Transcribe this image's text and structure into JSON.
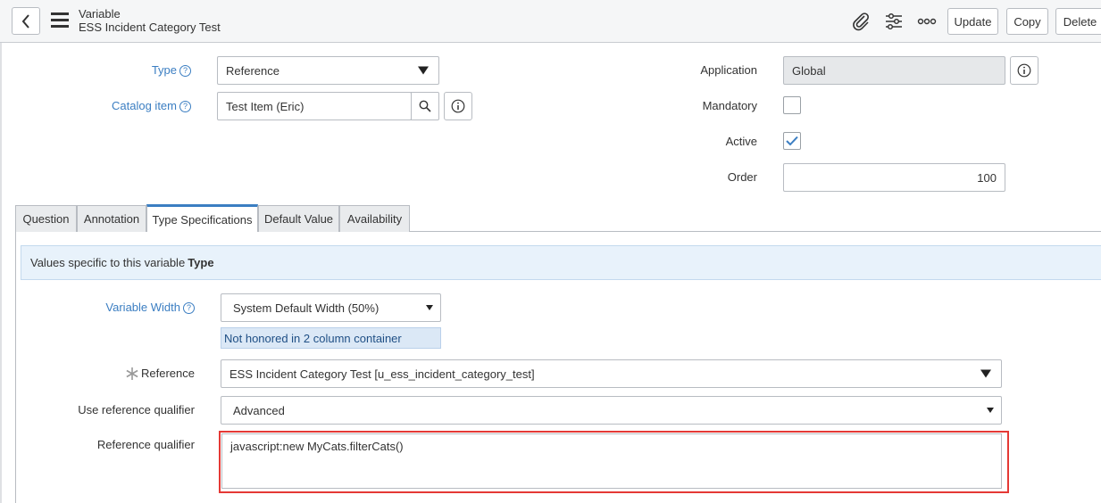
{
  "header": {
    "table_name": "Variable",
    "record_name": "ESS Incident Category Test",
    "buttons": {
      "update": "Update",
      "copy": "Copy",
      "delete": "Delete"
    }
  },
  "form": {
    "type": {
      "label": "Type",
      "value": "Reference"
    },
    "catalog_item": {
      "label": "Catalog item",
      "value": "Test Item (Eric)"
    },
    "application": {
      "label": "Application",
      "value": "Global"
    },
    "mandatory": {
      "label": "Mandatory",
      "checked": false
    },
    "active": {
      "label": "Active",
      "checked": true
    },
    "order": {
      "label": "Order",
      "value": "100"
    }
  },
  "tabs": [
    {
      "label": "Question",
      "active": false
    },
    {
      "label": "Annotation",
      "active": false
    },
    {
      "label": "Type Specifications",
      "active": true
    },
    {
      "label": "Default Value",
      "active": false
    },
    {
      "label": "Availability",
      "active": false
    }
  ],
  "type_specifications": {
    "note_prefix": "Values specific to this variable",
    "note_bold": "Type",
    "variable_width": {
      "label": "Variable Width",
      "value": "System Default Width (50%)",
      "hint": "Not honored in 2 column container"
    },
    "reference": {
      "label": "Reference",
      "value": "ESS Incident Category Test [u_ess_incident_category_test]"
    },
    "use_reference_qualifier": {
      "label": "Use reference qualifier",
      "value": "Advanced"
    },
    "reference_qualifier": {
      "label": "Reference qualifier",
      "value": "javascript:new MyCats.filterCats()"
    }
  },
  "colors": {
    "link": "#3b7ec2",
    "highlight": "#e53935",
    "note_bg": "#e8f2fb"
  }
}
